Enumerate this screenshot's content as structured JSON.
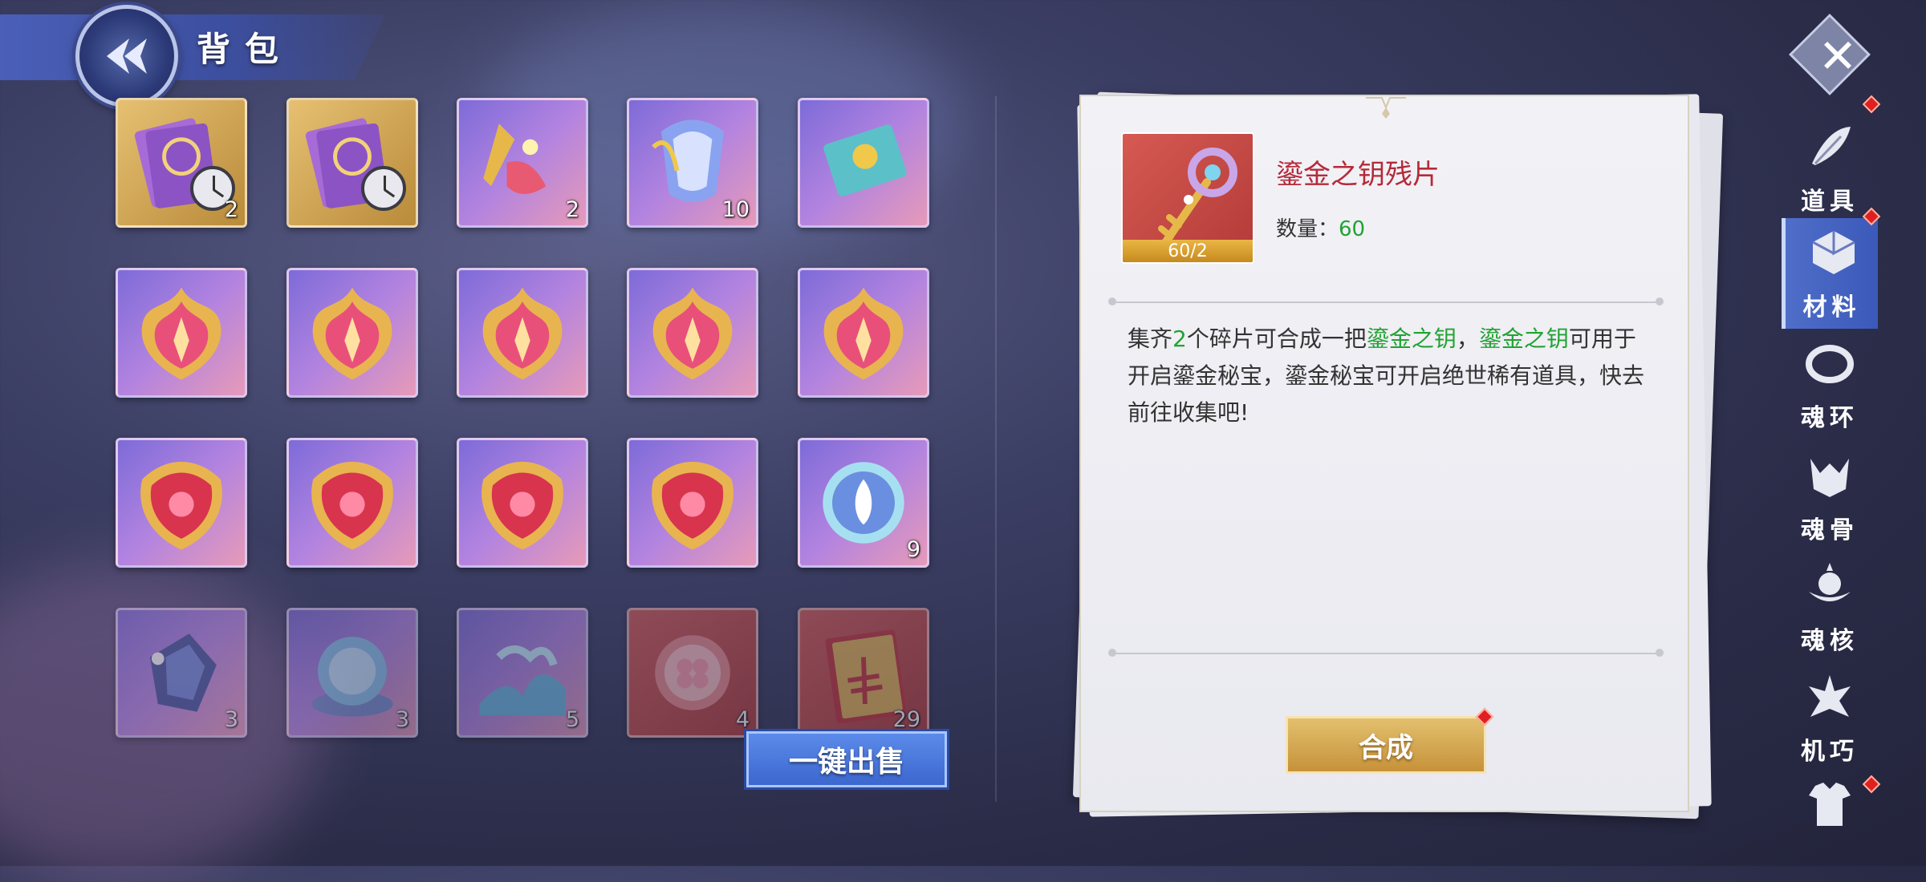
{
  "header": {
    "title": "背包"
  },
  "colors": {
    "highlight_green": "#22a233",
    "name_red": "#b52a3a",
    "accent_blue": "#3c67cf",
    "gold": "#c6923a"
  },
  "inventory": {
    "items": [
      {
        "icon": "scroll-clock-icon",
        "quality": "gold",
        "count": "2",
        "clock": true
      },
      {
        "icon": "scroll-clock-icon",
        "quality": "gold",
        "count": "",
        "clock": true
      },
      {
        "icon": "wand-icon",
        "quality": "purple",
        "count": "2"
      },
      {
        "icon": "armor-icon",
        "quality": "purple",
        "count": "10"
      },
      {
        "icon": "card-icon",
        "quality": "purple",
        "count": ""
      },
      {
        "icon": "flame-crest-icon",
        "quality": "purple",
        "count": ""
      },
      {
        "icon": "flame-crest-icon",
        "quality": "purple",
        "count": ""
      },
      {
        "icon": "flame-crest-icon",
        "quality": "purple",
        "count": ""
      },
      {
        "icon": "flame-crest-icon",
        "quality": "purple",
        "count": ""
      },
      {
        "icon": "flame-crest-icon",
        "quality": "purple",
        "count": ""
      },
      {
        "icon": "red-crest-icon",
        "quality": "purple",
        "count": ""
      },
      {
        "icon": "red-crest-icon",
        "quality": "purple",
        "count": ""
      },
      {
        "icon": "red-crest-icon",
        "quality": "purple",
        "count": ""
      },
      {
        "icon": "red-crest-icon",
        "quality": "purple",
        "count": ""
      },
      {
        "icon": "spirit-orb-icon",
        "quality": "purple",
        "count": "9"
      },
      {
        "icon": "crystal-icon",
        "quality": "purple",
        "count": "3"
      },
      {
        "icon": "crystal-globe-icon",
        "quality": "purple",
        "count": "3"
      },
      {
        "icon": "ice-wave-icon",
        "quality": "purple",
        "count": "5"
      },
      {
        "icon": "clover-orb-icon",
        "quality": "red",
        "count": "4"
      },
      {
        "icon": "red-book-icon",
        "quality": "red",
        "count": "29"
      }
    ],
    "sell_button": "一键出售"
  },
  "detail": {
    "name": "鎏金之钥残片",
    "progress": "60/2",
    "qty_label": "数量：",
    "qty_value": "60",
    "desc": {
      "p1": "集齐",
      "n": "2",
      "p2": "个碎片可合成一把",
      "key1": "鎏金之钥",
      "comma": "，",
      "key2": "鎏金之钥",
      "p3": "可用于开启鎏金秘宝，鎏金秘宝可开启绝世稀有道具，快去前往收集吧!"
    },
    "craft_button": "合成"
  },
  "sidebar": {
    "tabs": [
      {
        "label": "道具",
        "icon": "feather-icon"
      },
      {
        "label": "材料",
        "icon": "cube-icon"
      },
      {
        "label": "魂环",
        "icon": "ring-icon"
      },
      {
        "label": "魂骨",
        "icon": "bone-icon"
      },
      {
        "label": "魂核",
        "icon": "core-icon"
      },
      {
        "label": "机巧",
        "icon": "gear-icon"
      },
      {
        "label": "",
        "icon": "armor-icon"
      }
    ]
  }
}
